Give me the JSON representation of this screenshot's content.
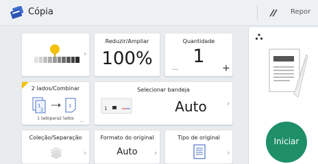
{
  "header": {
    "title": "Cópia",
    "app_icon": "copy-app-icon",
    "reset_label": "Repor",
    "reset_icon": "reset-slash-icon"
  },
  "tiles": {
    "density": {
      "icon": "density-slider-icon"
    },
    "reduce_enlarge": {
      "label": "Reduzir/Ampliar",
      "value": "100%"
    },
    "quantity": {
      "label": "Quantidade",
      "value": "1",
      "minus": "−",
      "plus": "+"
    },
    "duplex": {
      "label": "2 lados/Combinar",
      "sub_label": "1 ladopara2 lados",
      "more": "..."
    },
    "tray": {
      "label": "Selecionar bandeja",
      "value": "Auto"
    },
    "sort": {
      "label": "Coleção/Separação"
    },
    "original_format": {
      "label": "Formato do original",
      "value": "Auto"
    },
    "original_type": {
      "label": "Tipo de original"
    }
  },
  "start_button": {
    "label": "Iniciar",
    "color": "#1f8f68"
  },
  "colors": {
    "accent_yellow": "#f4c20d",
    "start_green": "#1f8f68"
  },
  "chevron": "›"
}
